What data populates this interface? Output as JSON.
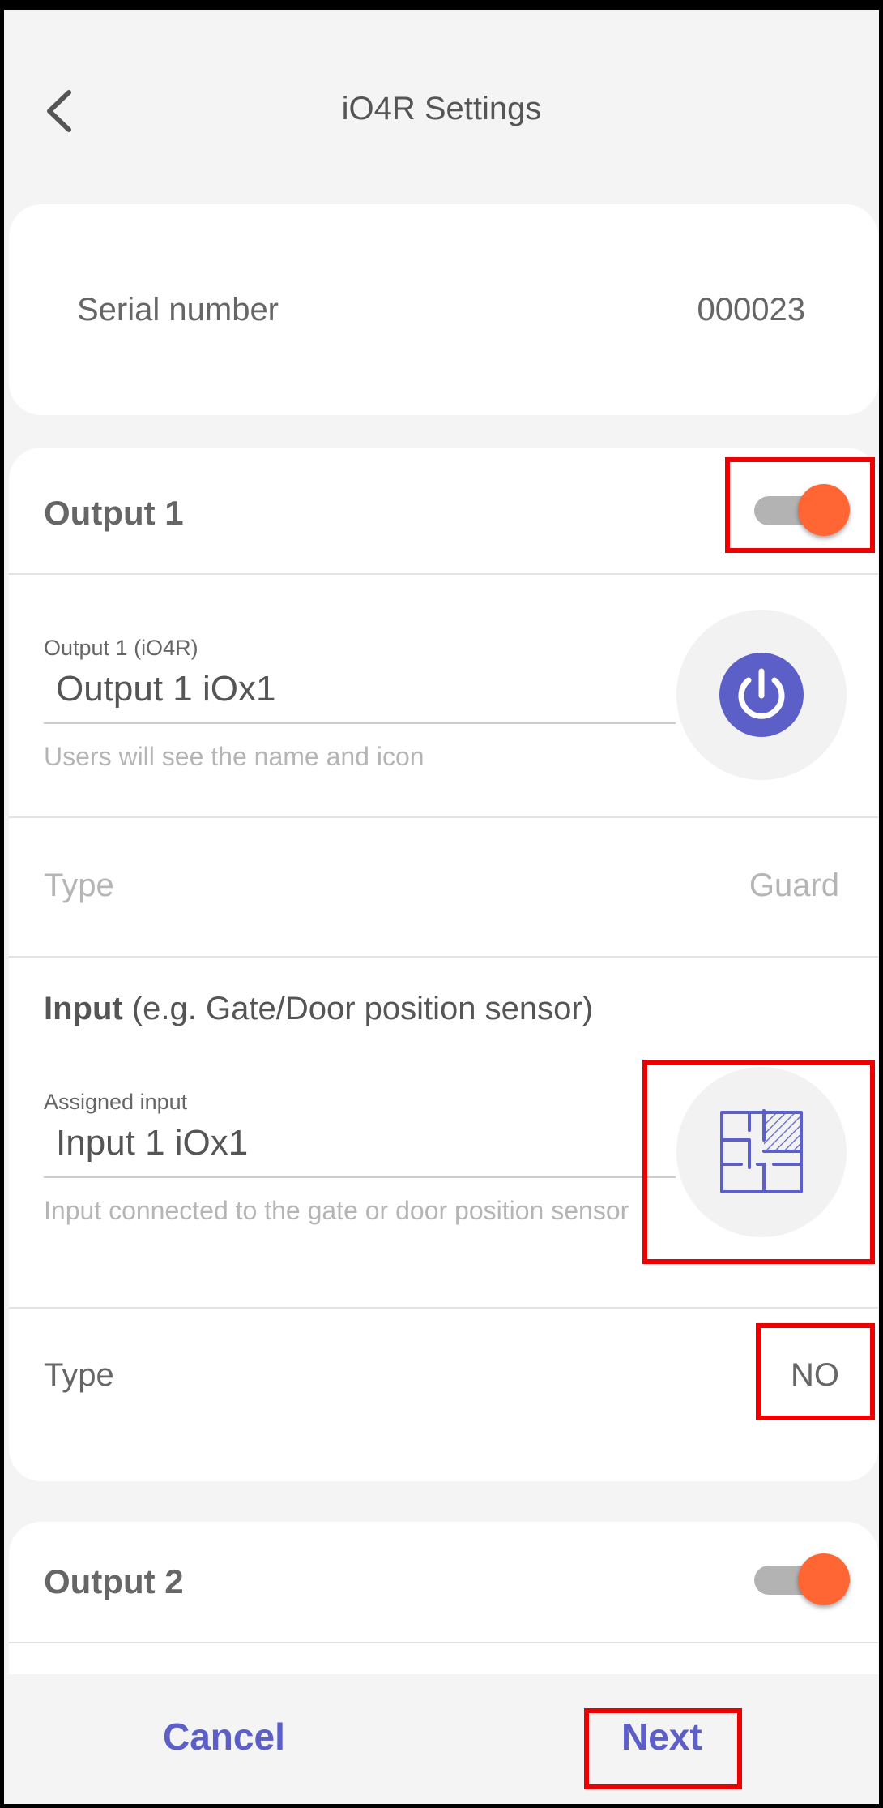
{
  "header": {
    "title": "iO4R Settings",
    "back_icon": "chevron-left-icon"
  },
  "serial": {
    "label": "Serial number",
    "value": "000023"
  },
  "output1": {
    "title": "Output 1",
    "enabled": true,
    "name_label": "Output 1 (iO4R)",
    "name_value": "Output 1 iOx1",
    "name_helper": "Users will see the name and icon",
    "icon": "power-icon",
    "type_label": "Type",
    "type_value": "Guard",
    "input_heading_bold": "Input",
    "input_heading_rest": " (e.g. Gate/Door position sensor)",
    "assigned_label": "Assigned input",
    "assigned_value": "Input 1 iOx1",
    "assigned_helper": "Input connected to the gate or door position sensor",
    "input_icon": "floorplan-icon",
    "input_type_label": "Type",
    "input_type_value": "NO"
  },
  "output2": {
    "title": "Output 2",
    "enabled": true
  },
  "footer": {
    "cancel": "Cancel",
    "next": "Next"
  },
  "colors": {
    "accent": "#5b5fc7",
    "toggle_on": "#ff6633",
    "highlight": "#ee0000"
  }
}
